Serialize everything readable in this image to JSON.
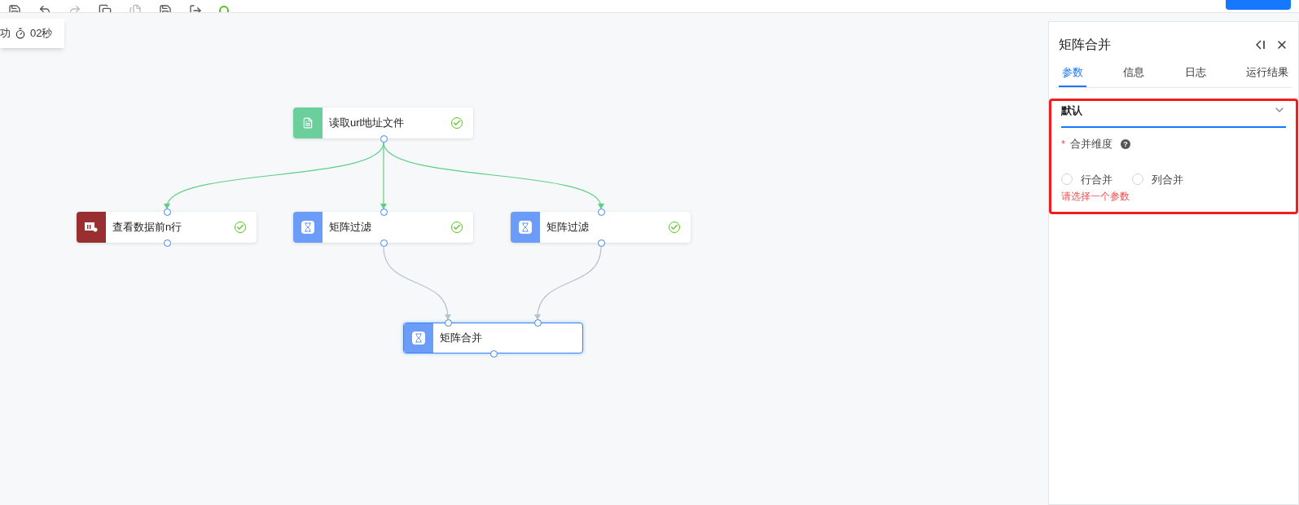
{
  "run_status": {
    "result": "功",
    "duration": "02秒"
  },
  "nodes": [
    {
      "label": "读取url地址文件",
      "kind": "file",
      "done": true,
      "selected": false
    },
    {
      "label": "查看数据前n行",
      "kind": "table",
      "done": true,
      "selected": false
    },
    {
      "label": "矩阵过滤",
      "kind": "hourglass",
      "done": true,
      "selected": false
    },
    {
      "label": "矩阵过滤",
      "kind": "hourglass",
      "done": true,
      "selected": false
    },
    {
      "label": "矩阵合并",
      "kind": "hourglass",
      "done": false,
      "selected": true
    }
  ],
  "panel": {
    "title": "矩阵合并",
    "tabs": [
      {
        "label": "参数",
        "selected": true
      },
      {
        "label": "信息",
        "selected": false
      },
      {
        "label": "日志",
        "selected": false
      },
      {
        "label": "运行结果",
        "selected": false
      }
    ],
    "section": {
      "title": "默认",
      "expanded": true
    },
    "field": {
      "label": "合并维度",
      "required_mark": "*",
      "help": "?",
      "options": [
        {
          "label": "行合并",
          "selected": false
        },
        {
          "label": "列合并",
          "selected": false
        }
      ],
      "error": "请选择一个参数"
    }
  }
}
